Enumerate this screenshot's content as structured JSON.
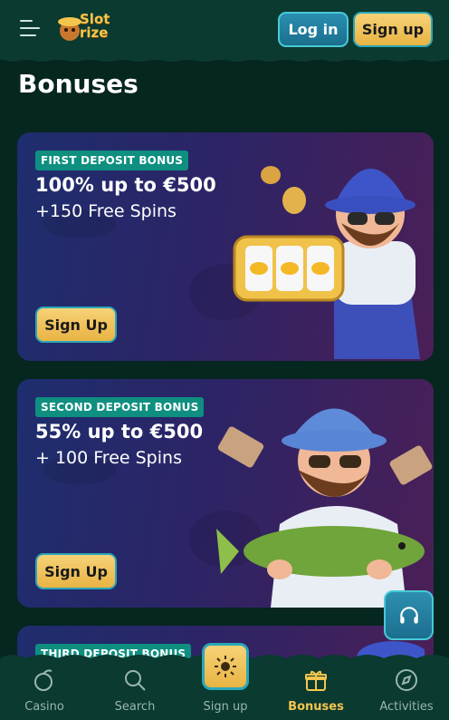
{
  "header": {
    "logo_text": "Slot\nrize",
    "login_label": "Log in",
    "signup_label": "Sign up"
  },
  "page": {
    "title": "Bonuses"
  },
  "bonuses": [
    {
      "badge": "FIRST DEPOSIT BONUS",
      "line1": "100% up to €500",
      "line2": "+150 Free Spins",
      "cta": "Sign Up"
    },
    {
      "badge": "SECOND DEPOSIT BONUS",
      "line1": "55% up to €500",
      "line2": "+ 100 Free Spins",
      "cta": "Sign Up"
    },
    {
      "badge": "THIRD DEPOSIT BONUS"
    }
  ],
  "bottom_nav": {
    "items": [
      {
        "label": "Casino",
        "icon": "casino-icon"
      },
      {
        "label": "Search",
        "icon": "search-icon"
      },
      {
        "label": "Sign up",
        "icon": "sun-icon"
      },
      {
        "label": "Bonuses",
        "icon": "gift-icon",
        "active": true
      },
      {
        "label": "Activities",
        "icon": "compass-icon"
      }
    ]
  },
  "colors": {
    "accent_gold": "#f4c64e",
    "teal_border": "#2ba7b8",
    "header_bg": "#0a3a30",
    "badge_bg": "#0e8f80"
  }
}
